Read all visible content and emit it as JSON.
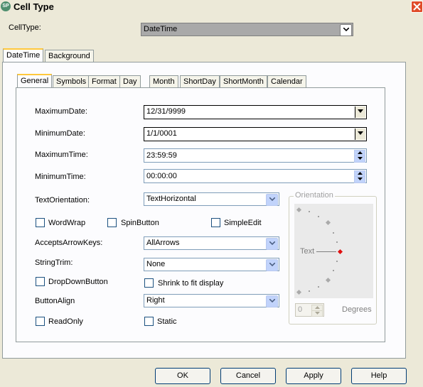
{
  "window": {
    "title": "Cell Type",
    "app_icon_text": "SP"
  },
  "celltype": {
    "label": "CellType:",
    "value": "DateTime"
  },
  "outer_tabs": [
    {
      "label": "DateTime"
    },
    {
      "label": "Background"
    }
  ],
  "inner_tabs": [
    {
      "label": "General"
    },
    {
      "label": "Symbols"
    },
    {
      "label": "Format"
    },
    {
      "label": "Day"
    },
    {
      "label": "Month"
    },
    {
      "label": "ShortDay"
    },
    {
      "label": "ShortMonth"
    },
    {
      "label": "Calendar"
    }
  ],
  "fields": {
    "maximum_date": {
      "label": "MaximumDate:",
      "value": "12/31/9999"
    },
    "minimum_date": {
      "label": "MinimumDate:",
      "value": "1/1/0001"
    },
    "maximum_time": {
      "label": "MaximumTime:",
      "value": "23:59:59"
    },
    "minimum_time": {
      "label": "MinimumTime:",
      "value": "00:00:00"
    },
    "text_orientation": {
      "label": "TextOrientation:",
      "value": "TextHorizontal"
    },
    "accepts_arrow_keys": {
      "label": "AcceptsArrowKeys:",
      "value": "AllArrows"
    },
    "string_trim": {
      "label": "StringTrim:",
      "value": "None"
    },
    "button_align": {
      "label": "ButtonAlign",
      "value": "Right"
    }
  },
  "checkboxes": {
    "word_wrap": {
      "label": "WordWrap",
      "checked": false
    },
    "spin_button": {
      "label": "SpinButton",
      "checked": false
    },
    "simple_edit": {
      "label": "SimpleEdit",
      "checked": false
    },
    "drop_down_button": {
      "label": "DropDownButton",
      "checked": false
    },
    "shrink_to_fit": {
      "label": "Shrink to fit display",
      "checked": false
    },
    "read_only": {
      "label": "ReadOnly",
      "checked": false
    },
    "static": {
      "label": "Static",
      "checked": false
    }
  },
  "orientation": {
    "title": "Orientation",
    "text_label": "Text",
    "degrees_value": "0",
    "degrees_label": "Degrees"
  },
  "buttons": {
    "ok": "OK",
    "cancel": "Cancel",
    "apply": "Apply",
    "help": "Help"
  }
}
